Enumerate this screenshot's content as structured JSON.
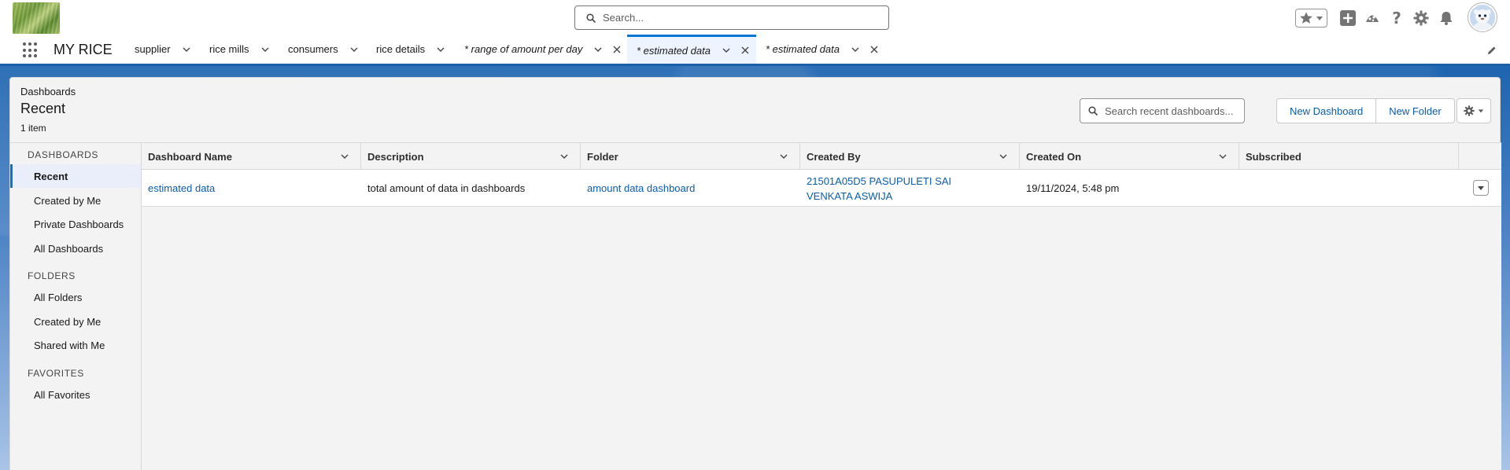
{
  "header": {
    "search_placeholder": "Search..."
  },
  "app_nav": {
    "app_name": "MY RICE",
    "tabs": [
      {
        "label": "supplier"
      },
      {
        "label": "rice mills"
      },
      {
        "label": "consumers"
      },
      {
        "label": "rice details"
      },
      {
        "label": "* range of amount per day"
      },
      {
        "label": "* estimated data"
      },
      {
        "label": "* estimated data"
      }
    ]
  },
  "page": {
    "breadcrumb": "Dashboards",
    "title": "Recent",
    "item_count": "1 item",
    "search_placeholder": "Search recent dashboards...",
    "new_dashboard_label": "New Dashboard",
    "new_folder_label": "New Folder"
  },
  "sidebar": {
    "dashboards_heading": "DASHBOARDS",
    "dashboards_items": [
      "Recent",
      "Created by Me",
      "Private Dashboards",
      "All Dashboards"
    ],
    "folders_heading": "FOLDERS",
    "folders_items": [
      "All Folders",
      "Created by Me",
      "Shared with Me"
    ],
    "favorites_heading": "FAVORITES",
    "favorites_items": [
      "All Favorites"
    ]
  },
  "table": {
    "columns": [
      "Dashboard Name",
      "Description",
      "Folder",
      "Created By",
      "Created On",
      "Subscribed"
    ],
    "rows": [
      {
        "name": "estimated data",
        "description": "total amount of data in dashboards",
        "folder": "amount data dashboard",
        "created_by": "21501A05D5 PASUPULETI SAI VENKATA ASWIJA",
        "created_on": "19/11/2024, 5:48 pm",
        "subscribed": ""
      }
    ]
  },
  "colors": {
    "brand_blue": "#0176d3",
    "link_blue": "#0b5cab",
    "backdrop_blue": "#1b5fa8"
  }
}
